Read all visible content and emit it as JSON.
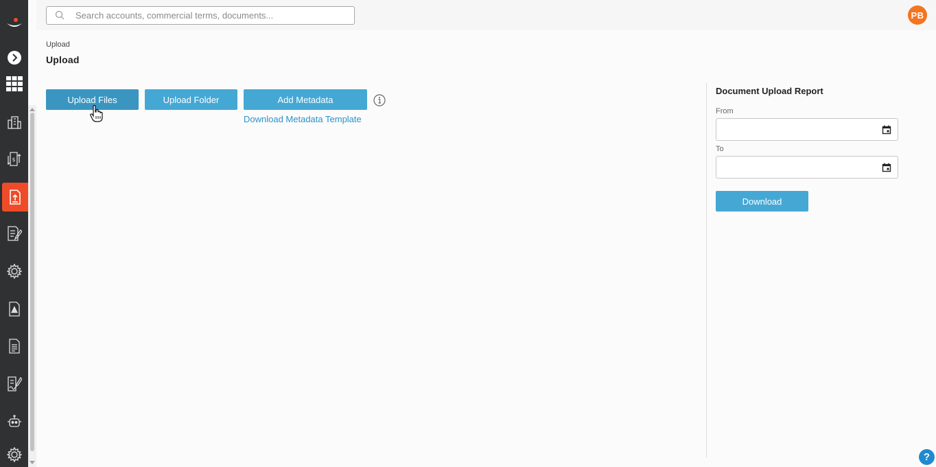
{
  "search": {
    "placeholder": "Search accounts, commercial terms, documents..."
  },
  "user": {
    "initials": "PB"
  },
  "breadcrumb": "Upload",
  "page_title": "Upload",
  "actions": {
    "upload_files": "Upload Files",
    "upload_folder": "Upload Folder",
    "add_metadata": "Add Metadata",
    "download_template": "Download Metadata Template"
  },
  "report": {
    "title": "Document Upload Report",
    "from_label": "From",
    "to_label": "To",
    "from_value": "",
    "to_value": "",
    "download_label": "Download"
  },
  "help": "?",
  "sidebar": {
    "items": [
      "logo-icon",
      "expand-icon",
      "apps-grid-icon",
      "accounts-icon",
      "commercial-terms-icon",
      "upload-document-icon",
      "contracts-icon",
      "settings-gear-icon",
      "alert-document-icon",
      "report-document-icon",
      "signature-document-icon",
      "bot-icon",
      "admin-gear-icon"
    ],
    "active": "upload-document-icon"
  },
  "colors": {
    "accent": "#45a8d4",
    "active": "#ef4b28",
    "avatar": "#f4741f",
    "sidebar": "#2f3133",
    "link": "#2a93c9"
  }
}
